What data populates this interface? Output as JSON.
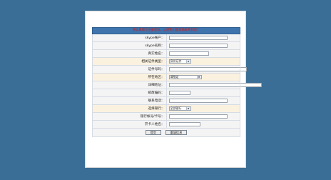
{
  "form": {
    "header_notice": "请认真填写注册资料，以便我们能准确联系到您！",
    "fields": [
      {
        "label": "skype帐户：",
        "type": "text",
        "value": ""
      },
      {
        "label": "skype名称：",
        "type": "text",
        "value": ""
      },
      {
        "label": "真实姓名：",
        "type": "text",
        "value": ""
      },
      {
        "label": "相关证件类型：",
        "type": "select",
        "value": "身份证件"
      },
      {
        "label": "证件号码：",
        "type": "text",
        "value": ""
      },
      {
        "label": "所在地区：",
        "type": "select",
        "value": "请指定"
      },
      {
        "label": "详细地址：",
        "type": "text",
        "value": ""
      },
      {
        "label": "邮政编码：",
        "type": "text",
        "value": ""
      },
      {
        "label": "联系电话：",
        "type": "text",
        "value": ""
      },
      {
        "label": "选择银行：",
        "type": "select",
        "value": "全部银行"
      },
      {
        "label": "银行帐号/卡号：",
        "type": "text",
        "value": ""
      },
      {
        "label": "开卡人姓名：",
        "type": "text",
        "value": ""
      }
    ],
    "submit_label": "提交",
    "reset_label": "重填信息"
  }
}
